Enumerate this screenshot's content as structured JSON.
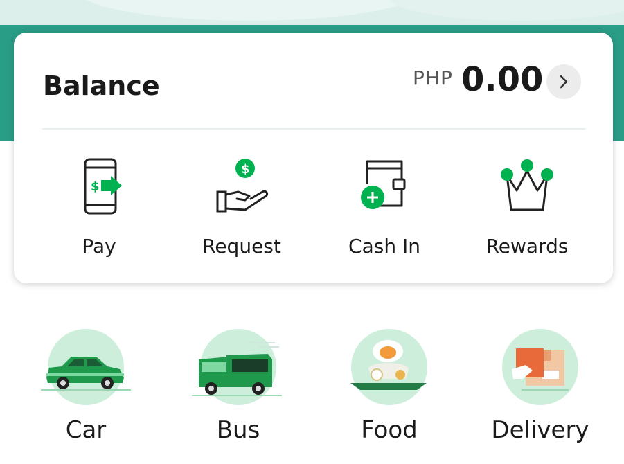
{
  "balance": {
    "label": "Balance",
    "currency": "PHP",
    "amount": "0.00"
  },
  "actions": [
    {
      "label": "Pay",
      "icon": "phone-pay-icon"
    },
    {
      "label": "Request",
      "icon": "hand-dollar-icon"
    },
    {
      "label": "Cash In",
      "icon": "wallet-plus-icon"
    },
    {
      "label": "Rewards",
      "icon": "crown-icon"
    }
  ],
  "services": [
    {
      "label": "Car",
      "icon": "car-icon"
    },
    {
      "label": "Bus",
      "icon": "bus-icon"
    },
    {
      "label": "Food",
      "icon": "food-icon"
    },
    {
      "label": "Delivery",
      "icon": "delivery-box-icon"
    }
  ],
  "colors": {
    "brand_green": "#00b14f",
    "header_teal": "#2a9d87",
    "icon_circle": "#cdeedb"
  }
}
